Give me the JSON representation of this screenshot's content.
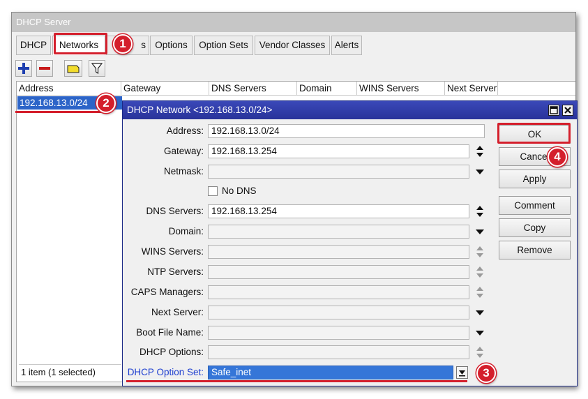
{
  "window": {
    "title": "DHCP Server"
  },
  "tabs": [
    "DHCP",
    "Networks",
    "s",
    "Options",
    "Option Sets",
    "Vendor Classes",
    "Alerts"
  ],
  "toolbar": {
    "add_icon": "plus-icon",
    "remove_icon": "minus-icon",
    "comment_icon": "note-icon",
    "filter_icon": "filter-icon"
  },
  "list": {
    "columns": [
      "Address",
      "Gateway",
      "DNS Servers",
      "Domain",
      "WINS Servers",
      "Next Server"
    ],
    "rows": [
      {
        "address": "192.168.13.0/24"
      }
    ],
    "status": "1 item (1 selected)"
  },
  "dialog": {
    "title": "DHCP Network <192.168.13.0/24>",
    "fields": {
      "address": {
        "label": "Address:",
        "value": "192.168.13.0/24"
      },
      "gateway": {
        "label": "Gateway:",
        "value": "192.168.13.254"
      },
      "netmask": {
        "label": "Netmask:",
        "value": ""
      },
      "no_dns": {
        "label": "No DNS",
        "checked": false
      },
      "dns_servers": {
        "label": "DNS Servers:",
        "value": "192.168.13.254"
      },
      "domain": {
        "label": "Domain:",
        "value": ""
      },
      "wins_servers": {
        "label": "WINS Servers:",
        "value": ""
      },
      "ntp_servers": {
        "label": "NTP Servers:",
        "value": ""
      },
      "caps_managers": {
        "label": "CAPS Managers:",
        "value": ""
      },
      "next_server": {
        "label": "Next Server:",
        "value": ""
      },
      "boot_file_name": {
        "label": "Boot File Name:",
        "value": ""
      },
      "dhcp_options": {
        "label": "DHCP Options:",
        "value": ""
      },
      "dhcp_option_set": {
        "label": "DHCP Option Set:",
        "value": "Safe_inet"
      }
    },
    "buttons": {
      "ok": "OK",
      "cancel": "Cancel",
      "apply": "Apply",
      "comment": "Comment",
      "copy": "Copy",
      "remove": "Remove"
    }
  },
  "callouts": [
    "1",
    "2",
    "3",
    "4"
  ],
  "colors": {
    "highlight_red": "#d41f2c",
    "dialog_title": "#2e3aa6",
    "selection": "#2c64c8"
  }
}
